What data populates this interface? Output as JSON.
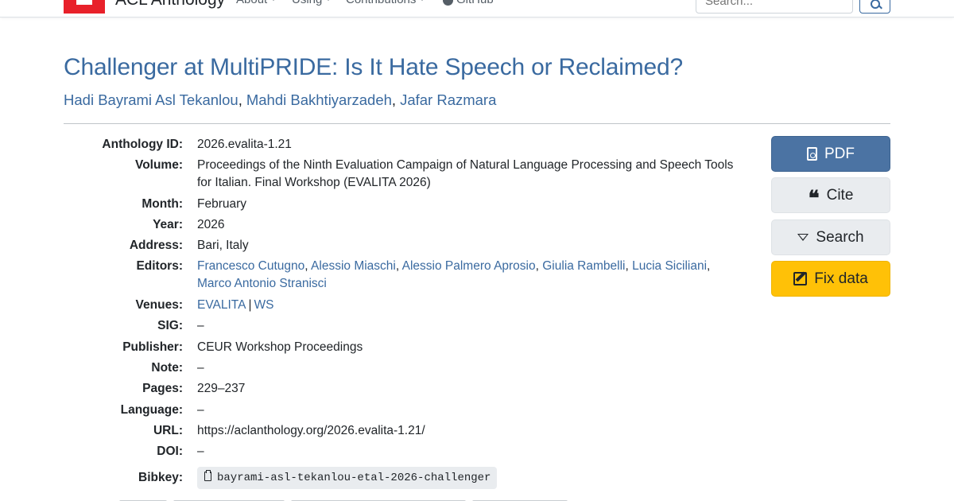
{
  "navbar": {
    "brand": "ACL Anthology",
    "links": [
      "About",
      "Using",
      "Contributions",
      "GitHub"
    ],
    "search_placeholder": "Search..."
  },
  "paper": {
    "title": "Challenger at MultiPRIDE: Is It Hate Speech or Reclaimed?",
    "authors": [
      "Hadi Bayrami Asl Tekanlou",
      "Mahdi Bakhtiyarzadeh",
      "Jafar Razmara"
    ]
  },
  "details": {
    "anthology_id": {
      "label": "Anthology ID:",
      "value": "2026.evalita-1.21"
    },
    "volume": {
      "label": "Volume:",
      "line1": "Proceedings of the Ninth Evaluation Campaign of Natural Language Processing and Speech Tools",
      "line2": "for Italian. Final Workshop (EVALITA 2026)"
    },
    "month": {
      "label": "Month:",
      "value": "February"
    },
    "year": {
      "label": "Year:",
      "value": "2026"
    },
    "address": {
      "label": "Address:",
      "value": "Bari, Italy"
    },
    "editors": {
      "label": "Editors:",
      "names": [
        "Francesco Cutugno",
        "Alessio Miaschi",
        "Alessio Palmero Aprosio",
        "Giulia Rambelli",
        "Lucia Siciliani",
        "Marco Antonio Stranisci"
      ]
    },
    "venues": {
      "label": "Venues:",
      "items": [
        "EVALITA",
        "WS"
      ],
      "separator": "|"
    },
    "sig": {
      "label": "SIG:",
      "value": "–"
    },
    "publisher": {
      "label": "Publisher:",
      "value": "CEUR Workshop Proceedings"
    },
    "note": {
      "label": "Note:",
      "value": "–"
    },
    "pages": {
      "label": "Pages:",
      "value": "229–237"
    },
    "language": {
      "label": "Language:",
      "value": "–"
    },
    "url": {
      "label": "URL:",
      "value": "https://aclanthology.org/2026.evalita-1.21/"
    },
    "doi": {
      "label": "DOI:",
      "value": "–"
    },
    "bibkey": {
      "label": "Bibkey:",
      "value": "bayrami-asl-tekanlou-etal-2026-challenger"
    }
  },
  "actions": {
    "pdf": "PDF",
    "cite": "Cite",
    "search": "Search",
    "fix": "Fix data"
  },
  "colors": {
    "link": "#3a6aa0",
    "pdf_button": "#4b73a3",
    "fix_button": "#ffc107",
    "logo": "#e8212a"
  }
}
